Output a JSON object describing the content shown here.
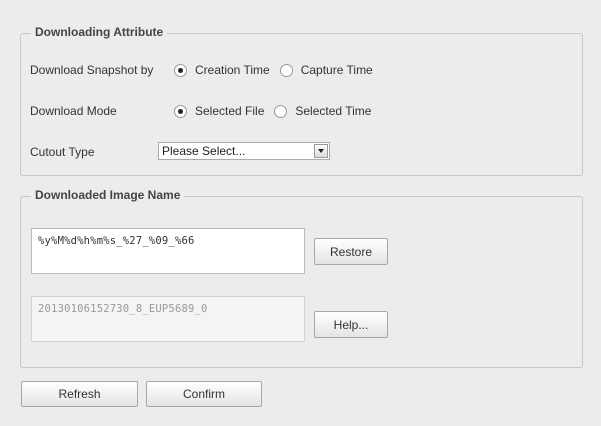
{
  "download_attr": {
    "legend": "Downloading Attribute",
    "snapshot_label": "Download Snapshot by",
    "snapshot_options": [
      "Creation Time",
      "Capture Time"
    ],
    "snapshot_selected": "Creation Time",
    "mode_label": "Download Mode",
    "mode_options": [
      "Selected File",
      "Selected Time"
    ],
    "mode_selected": "Selected File",
    "cutout_label": "Cutout Type",
    "cutout_value": "Please Select..."
  },
  "image_name": {
    "legend": "Downloaded Image Name",
    "pattern_value": "%y%M%d%h%m%s_%27_%09_%66",
    "preview_value": "20130106152730_8_EUP5689_0",
    "restore_label": "Restore",
    "help_label": "Help..."
  },
  "footer": {
    "refresh_label": "Refresh",
    "confirm_label": "Confirm"
  }
}
